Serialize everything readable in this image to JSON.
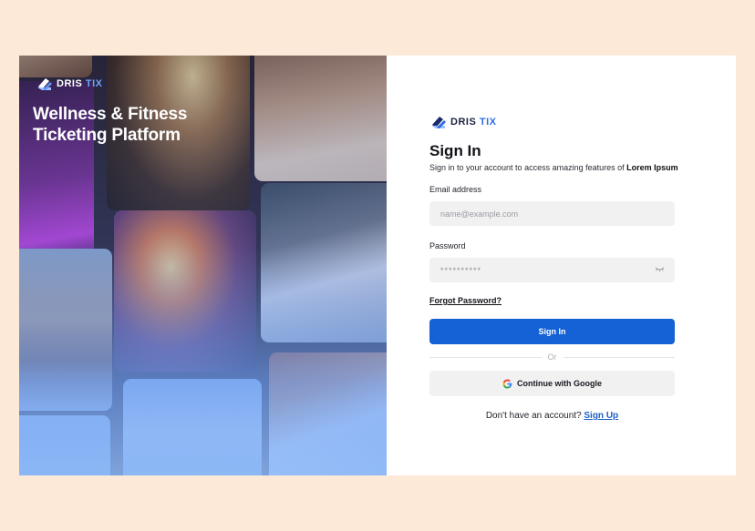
{
  "brand": {
    "name_primary": "DRIS",
    "name_accent": "TIX",
    "logo_icon": "ticket-icon",
    "accent_color": "#2f6be0"
  },
  "hero": {
    "title_line1": "Wellness & Fitness",
    "title_line2": "Ticketing Platform"
  },
  "form": {
    "title": "Sign In",
    "subtitle": "Sign in to your account to access amazing features of ",
    "subtitle_bold": "Lorem Ipsum",
    "email_label": "Email address",
    "email_placeholder": "name@example.com",
    "password_label": "Password",
    "password_value": "**********",
    "password_toggle_icon": "eye-closed-icon",
    "forgot_label": "Forgot Password?",
    "submit_label": "Sign In",
    "divider_label": "Or",
    "google_label": "Continue with Google",
    "google_icon": "google-icon",
    "signup_prompt": "Don't have an account?",
    "signup_link": "Sign Up"
  },
  "colors": {
    "page_background": "#fde9d8",
    "primary_button": "#1462d6",
    "input_background": "#f1f1f2",
    "link": "#1b5fc6"
  }
}
